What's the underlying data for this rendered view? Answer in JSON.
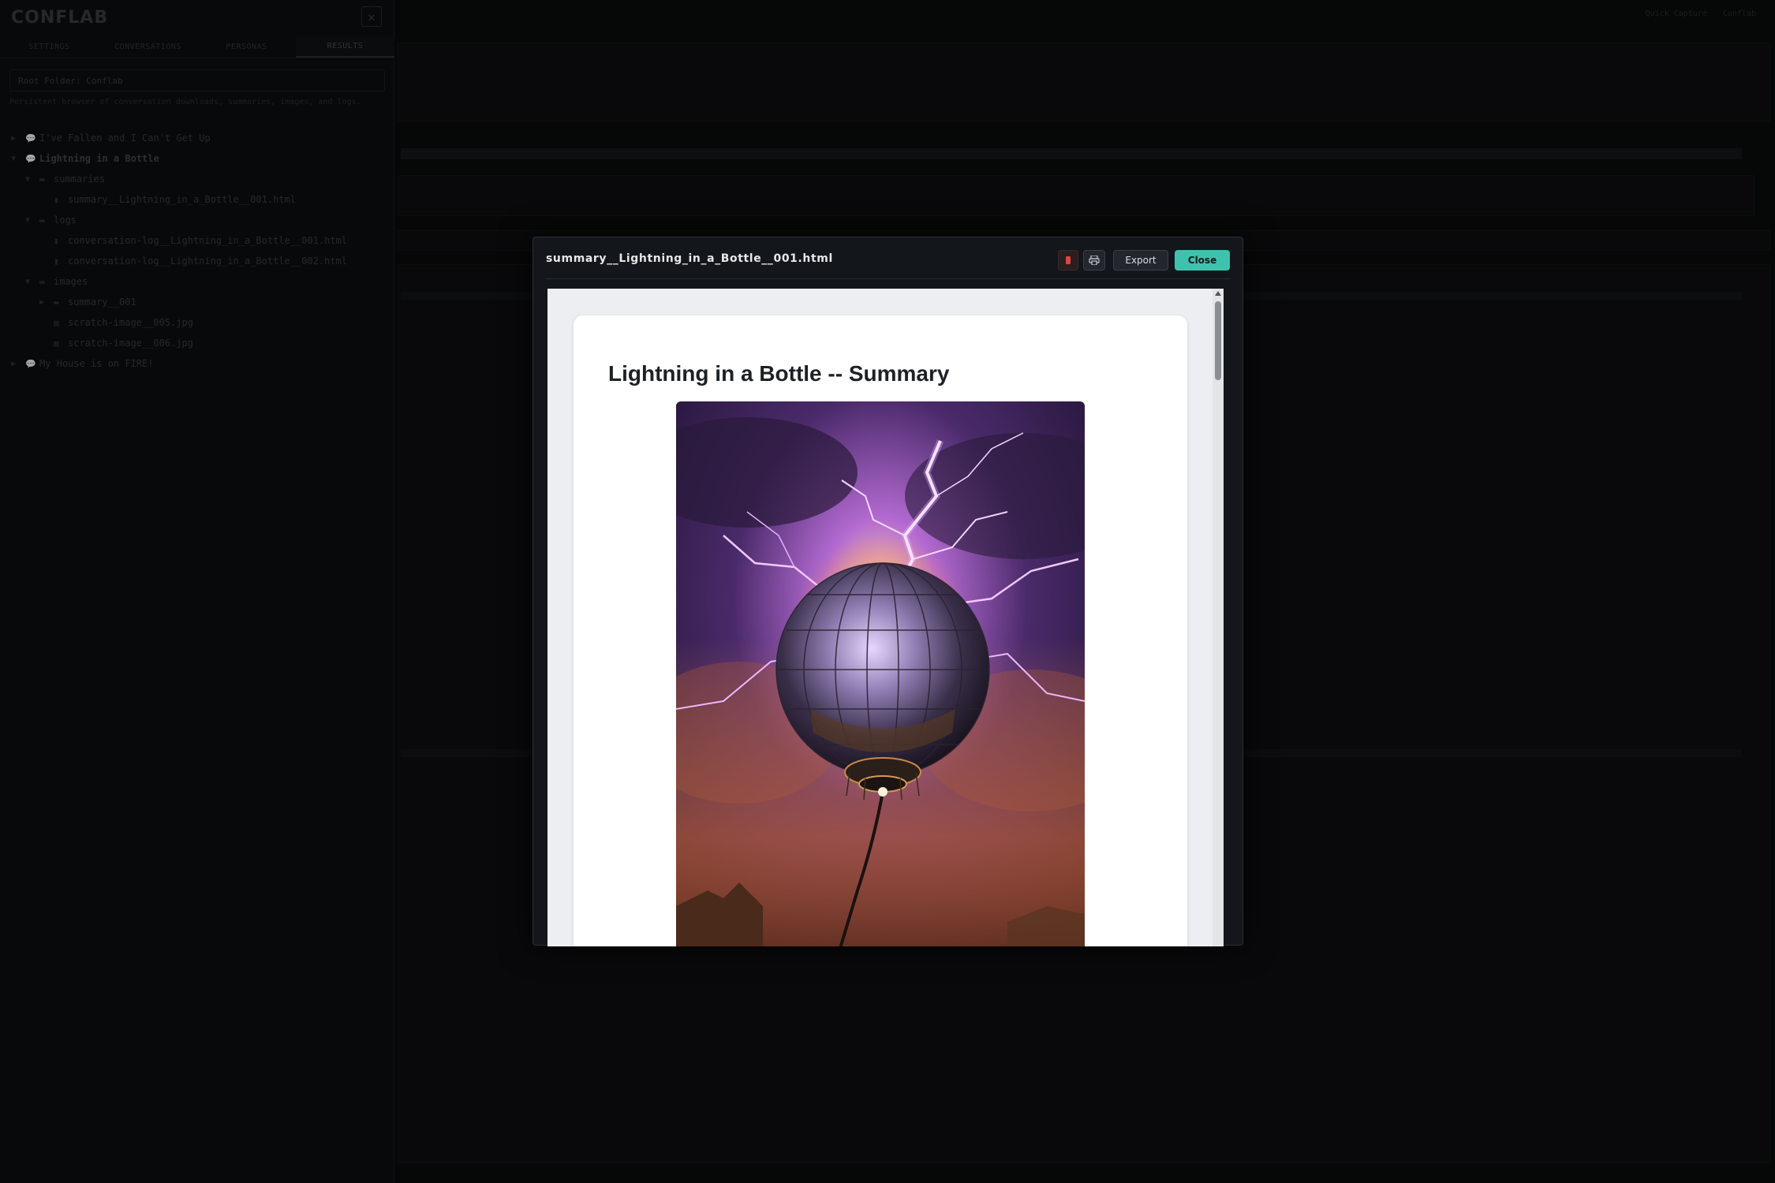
{
  "app": {
    "logo": "CONFLAB",
    "top_right": [
      "Quick Capture",
      "Conflab"
    ]
  },
  "sidebar": {
    "tabs": [
      "SETTINGS",
      "CONVERSATIONS",
      "PERSONAS",
      "RESULTS"
    ],
    "active_tab": "RESULTS",
    "root_folder": "Root Folder: Conflab",
    "description": "Persistent browser of conversation downloads, summaries, images, and logs.",
    "tree": [
      {
        "label": "I've Fallen and I Can't Get Up",
        "depth": 0,
        "arrow": "▶",
        "icon": "chat"
      },
      {
        "label": "Lightning in a Bottle",
        "depth": 0,
        "arrow": "▼",
        "icon": "chat",
        "bold": true
      },
      {
        "label": "summaries",
        "depth": 1,
        "arrow": "▼",
        "icon": "folder"
      },
      {
        "label": "summary__Lightning_in_a_Bottle__001.html",
        "depth": 2,
        "arrow": "",
        "icon": "file"
      },
      {
        "label": "logs",
        "depth": 1,
        "arrow": "▼",
        "icon": "folder"
      },
      {
        "label": "conversation-log__Lightning_in_a_Bottle__001.html",
        "depth": 2,
        "arrow": "",
        "icon": "file"
      },
      {
        "label": "conversation-log__Lightning_in_a_Bottle__002.html",
        "depth": 2,
        "arrow": "",
        "icon": "file"
      },
      {
        "label": "images",
        "depth": 1,
        "arrow": "▼",
        "icon": "folder"
      },
      {
        "label": "summary__001",
        "depth": 2,
        "arrow": "▶",
        "icon": "folder"
      },
      {
        "label": "scratch-image__005.jpg",
        "depth": 2,
        "arrow": "",
        "icon": "image"
      },
      {
        "label": "scratch-image__006.jpg",
        "depth": 2,
        "arrow": "",
        "icon": "image"
      },
      {
        "label": "My House is on FIRE!",
        "depth": 0,
        "arrow": "▶",
        "icon": "chat"
      }
    ]
  },
  "modal": {
    "title": "summary__Lightning_in_a_Bottle__001.html",
    "export_label": "Export",
    "close_label": "Close",
    "doc_title": "Lightning in a Bottle -- Summary"
  },
  "colors": {
    "accent": "#3fc2ad",
    "modal_bg": "#13161b",
    "app_bg": "#0a0b0c"
  }
}
